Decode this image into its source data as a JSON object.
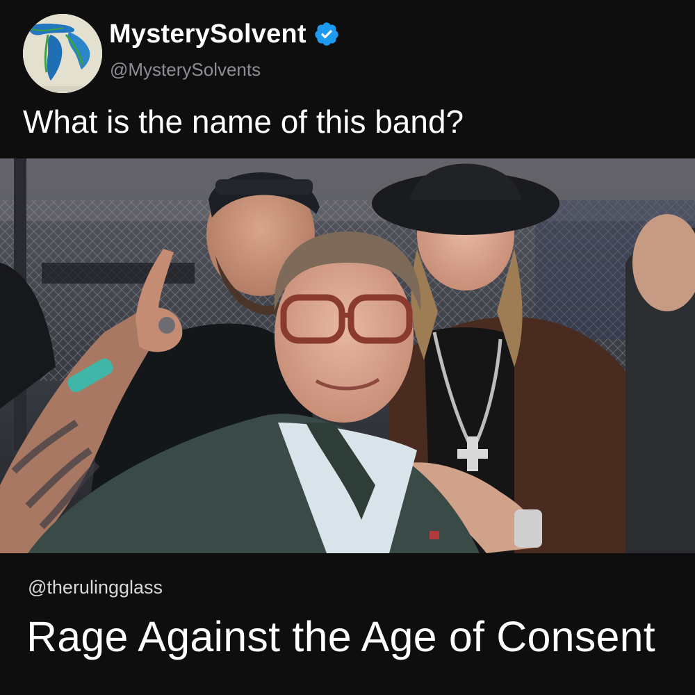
{
  "header": {
    "display_name": "MysterySolvent",
    "handle": "@MysterySolvents",
    "verified": true,
    "avatar_icon": "great-lakes-map-avatar"
  },
  "tweet": {
    "text": "What is the name of this band?",
    "photo_description_icon": "selfie-photo"
  },
  "reply": {
    "handle": "@therulingglass",
    "text": "Rage Against the Age of Consent"
  },
  "colors": {
    "background": "#0e0e0f",
    "verified_badge": "#1d9bf0",
    "handle_gray": "#8b8f95"
  }
}
